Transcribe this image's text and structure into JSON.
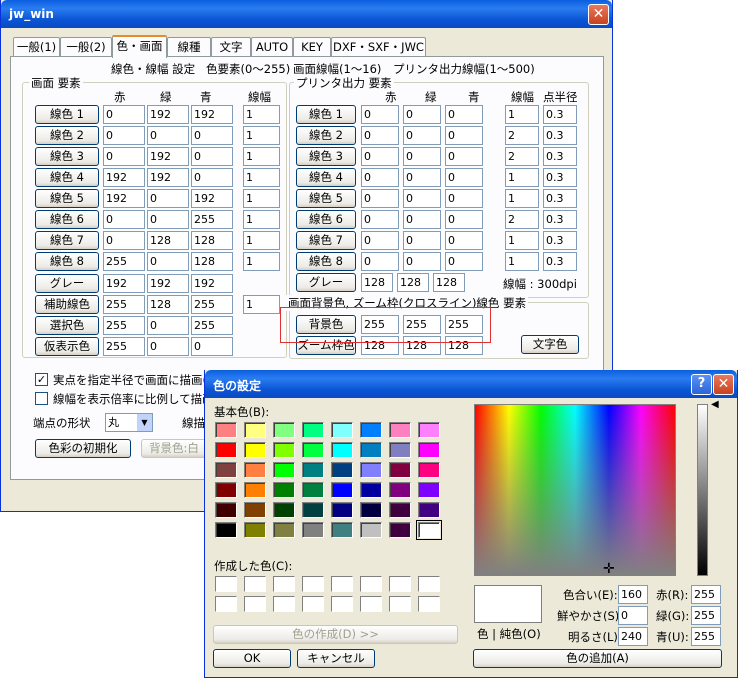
{
  "main": {
    "title": "jw_win",
    "close_glyph": "✕",
    "tabs": [
      "一般(1)",
      "一般(2)",
      "色・画面",
      "線種",
      "文字",
      "AUTO",
      "KEY",
      "DXF・SXF・JWC"
    ],
    "header": {
      "heading": "線色・線幅 設定",
      "note_rgb": "色要素(0〜255)",
      "note_width": "画面線幅(1〜16)",
      "note_print": "プリンタ出力線幅(1〜500)"
    },
    "screen_group": {
      "title": "画面 要素",
      "col_r": "赤",
      "col_g": "緑",
      "col_b": "青",
      "col_w": "線幅",
      "rows": [
        {
          "label": "線色 1",
          "r": "0",
          "g": "192",
          "b": "192",
          "w": "1"
        },
        {
          "label": "線色 2",
          "r": "0",
          "g": "0",
          "b": "0",
          "w": "1"
        },
        {
          "label": "線色 3",
          "r": "0",
          "g": "192",
          "b": "0",
          "w": "1"
        },
        {
          "label": "線色 4",
          "r": "192",
          "g": "192",
          "b": "0",
          "w": "1"
        },
        {
          "label": "線色 5",
          "r": "192",
          "g": "0",
          "b": "192",
          "w": "1"
        },
        {
          "label": "線色 6",
          "r": "0",
          "g": "0",
          "b": "255",
          "w": "1"
        },
        {
          "label": "線色 7",
          "r": "0",
          "g": "128",
          "b": "128",
          "w": "1"
        },
        {
          "label": "線色 8",
          "r": "255",
          "g": "0",
          "b": "128",
          "w": "1"
        }
      ],
      "gray": {
        "label": "グレー",
        "r": "192",
        "g": "192",
        "b": "192"
      },
      "aux": {
        "label": "補助線色",
        "r": "255",
        "g": "128",
        "b": "255",
        "w": "1"
      },
      "select": {
        "label": "選択色",
        "r": "255",
        "g": "0",
        "b": "255"
      },
      "temp": {
        "label": "仮表示色",
        "r": "255",
        "g": "0",
        "b": "0"
      }
    },
    "print_group": {
      "title": "プリンタ出力 要素",
      "col_r": "赤",
      "col_g": "緑",
      "col_b": "青",
      "col_w": "線幅",
      "col_p": "点半径",
      "rows": [
        {
          "label": "線色 1",
          "r": "0",
          "g": "0",
          "b": "0",
          "w": "1",
          "p": "0.3"
        },
        {
          "label": "線色 2",
          "r": "0",
          "g": "0",
          "b": "0",
          "w": "2",
          "p": "0.3"
        },
        {
          "label": "線色 3",
          "r": "0",
          "g": "0",
          "b": "0",
          "w": "2",
          "p": "0.3"
        },
        {
          "label": "線色 4",
          "r": "0",
          "g": "0",
          "b": "0",
          "w": "1",
          "p": "0.3"
        },
        {
          "label": "線色 5",
          "r": "0",
          "g": "0",
          "b": "0",
          "w": "1",
          "p": "0.3"
        },
        {
          "label": "線色 6",
          "r": "0",
          "g": "0",
          "b": "0",
          "w": "2",
          "p": "0.3"
        },
        {
          "label": "線色 7",
          "r": "0",
          "g": "0",
          "b": "0",
          "w": "1",
          "p": "0.3"
        },
        {
          "label": "線色 8",
          "r": "0",
          "g": "0",
          "b": "0",
          "w": "1",
          "p": "0.3"
        }
      ],
      "gray": {
        "label": "グレー",
        "r": "128",
        "g": "128",
        "b": "128"
      },
      "dpi": "線幅 : 300dpi"
    },
    "bg_group": {
      "title": "画面背景色, ズーム枠(クロスライン)線色 要素",
      "bg": {
        "label": "背景色",
        "r": "255",
        "g": "255",
        "b": "255"
      },
      "zoom": {
        "label": "ズーム枠色",
        "r": "128",
        "g": "128",
        "b": "128"
      },
      "text_color_btn": "文字色"
    },
    "options": {
      "check1": "実点を指定半径で画面に描画(",
      "check2": "線幅を表示倍率に比例して描画",
      "endpoint_label": "端点の形状",
      "endpoint_value": "丸",
      "line_draw_label": "線描",
      "init_button": "色彩の初期化",
      "bg_button": "背景色:白",
      "check_glyph": "✓"
    }
  },
  "dialog": {
    "title": "色の設定",
    "help_glyph": "?",
    "close_glyph": "✕",
    "basic_label": "基本色(B):",
    "custom_label": "作成した色(C):",
    "define_button": "色の作成(D) >>",
    "ok": "OK",
    "cancel": "キャンセル",
    "color_solid_label": "色 | 純色(O)",
    "add_button": "色の追加(A)",
    "hue_label": "色合い(E):",
    "hue": "160",
    "sat_label": "鮮やかさ(S):",
    "sat": "0",
    "lum_label": "明るさ(L):",
    "lum": "240",
    "red_label": "赤(R):",
    "red": "255",
    "green_label": "緑(G):",
    "green": "255",
    "blue_label": "青(U):",
    "blue": "255",
    "basic_colors": [
      [
        "#ff8080",
        "#ffff80",
        "#80ff80",
        "#00ff80",
        "#80ffff",
        "#0080ff",
        "#ff80c0",
        "#ff80ff"
      ],
      [
        "#ff0000",
        "#ffff00",
        "#80ff00",
        "#00ff40",
        "#00ffff",
        "#0080c0",
        "#8080c0",
        "#ff00ff"
      ],
      [
        "#804040",
        "#ff8040",
        "#00ff00",
        "#008080",
        "#004080",
        "#8080ff",
        "#800040",
        "#ff0080"
      ],
      [
        "#800000",
        "#ff8000",
        "#008000",
        "#008040",
        "#0000ff",
        "#0000a0",
        "#800080",
        "#8000ff"
      ],
      [
        "#400000",
        "#804000",
        "#004000",
        "#004040",
        "#000080",
        "#000040",
        "#400040",
        "#400080"
      ],
      [
        "#000000",
        "#808000",
        "#808040",
        "#808080",
        "#408080",
        "#c0c0c0",
        "#400040",
        "#ffffff"
      ]
    ]
  }
}
